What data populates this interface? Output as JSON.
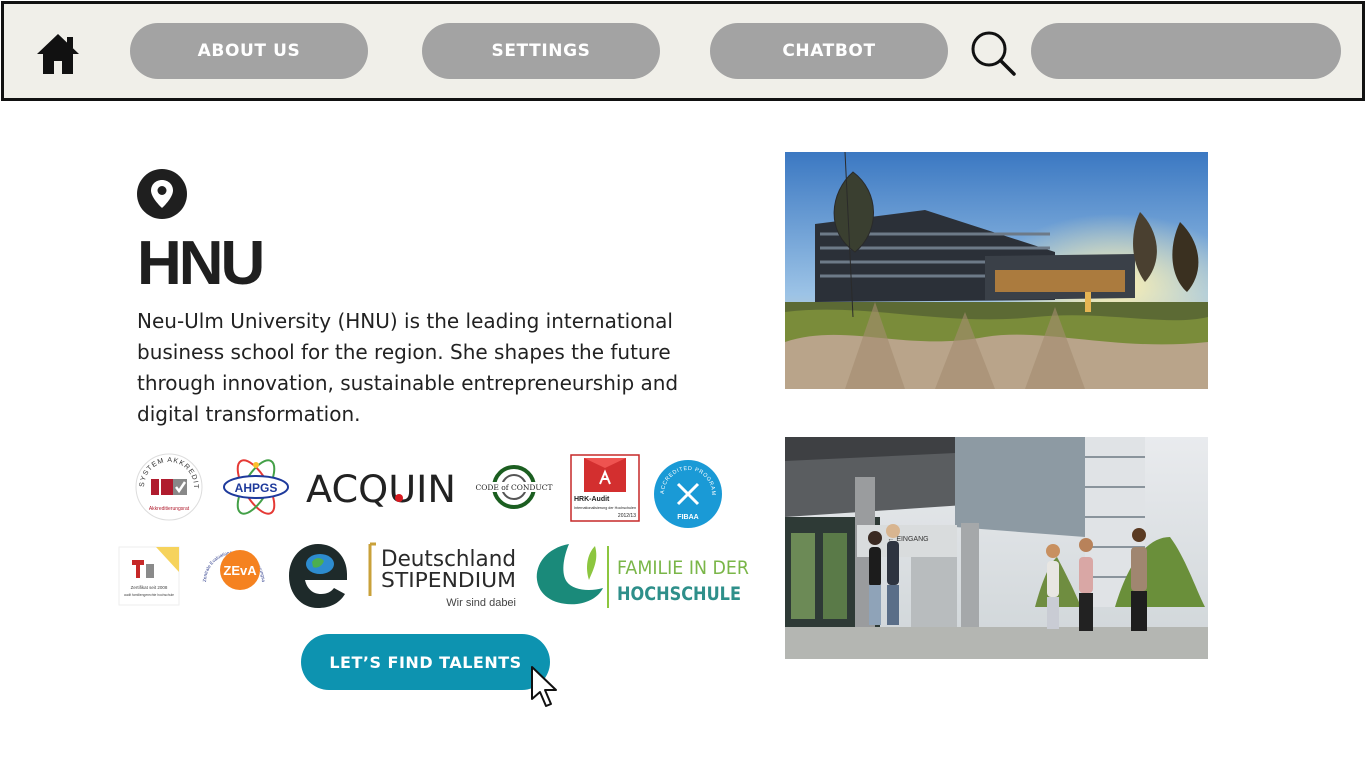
{
  "nav": {
    "home_icon": "home-icon",
    "about_label": "ABOUT US",
    "settings_label": "SETTINGS",
    "chatbot_label": "CHATBOT",
    "search_icon": "search-icon",
    "search_value": "",
    "search_placeholder": ""
  },
  "main": {
    "location_icon": "map-pin-icon",
    "title": "HNU",
    "description": "Neu-Ulm University (HNU) is the leading international business school for the region. She shapes the future through innovation, sustainable entrepreneurship and digital transformation.",
    "cta_label": "LET’S FIND TALENTS"
  },
  "logos": {
    "system_akkreditiert": {
      "ring_text": "SYSTEM AKKREDITIERT",
      "bottom_text": "Akkreditierungsrat"
    },
    "ahpgs": {
      "text": "AHPGS"
    },
    "acquin": {
      "text": "ACQUIN"
    },
    "code_of_conduct": {
      "text": "CODE of CONDUCT"
    },
    "hrk_audit": {
      "title": "HRK-Audit",
      "subtitle": "Internationalisierung der Hochschulen",
      "year": "2012/13"
    },
    "fibaa": {
      "ring_text": "ACCREDITED PROGRAMME",
      "name": "FIBAA"
    },
    "audit_familie": {
      "line1": "Zertifikat seit 2008",
      "line2": "audit familiengerechte hochschule"
    },
    "zeva": {
      "name": "ZEvA",
      "ring_text": "Zentrale Evaluations- und Akkreditierungsagentur Hannover"
    },
    "deutschland_stipendium": {
      "line1": "Deutschland",
      "line2": "STIPENDIUM",
      "tagline": "Wir sind dabei"
    },
    "familie_hochschule": {
      "line1": "FAMILIE IN DER",
      "line2": "HOCHSCHULE"
    }
  },
  "photos": {
    "campus_sign": "← EINGANG"
  },
  "colors": {
    "nav_bg": "#f0efe9",
    "pill_bg": "#a3a3a3",
    "cta_bg": "#0d93b0",
    "text": "#1f1f1f"
  }
}
